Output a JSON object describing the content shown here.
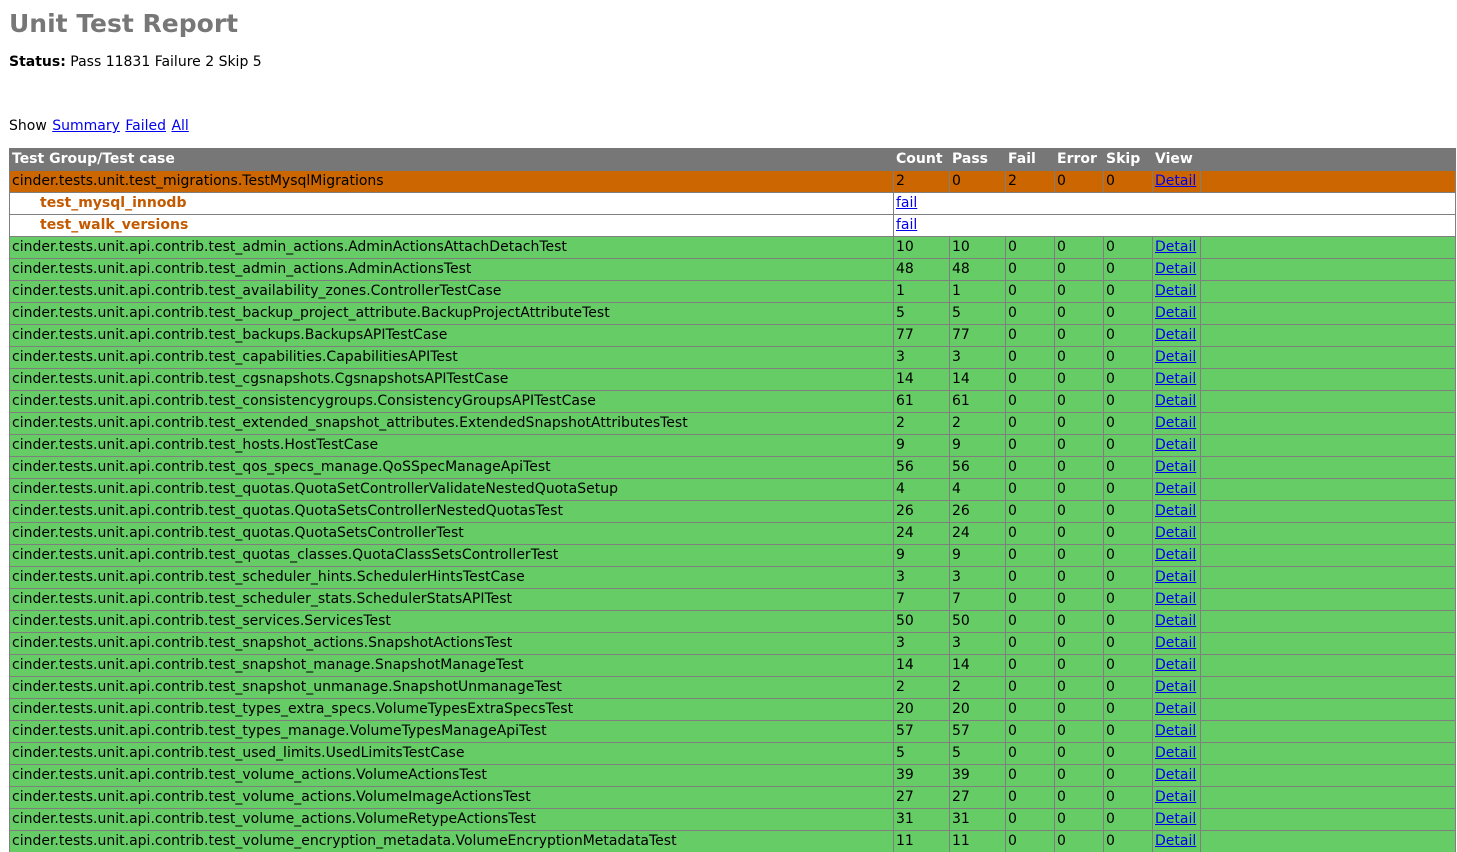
{
  "title": "Unit Test Report",
  "status": {
    "label": "Status:",
    "value": "Pass 11831 Failure 2 Skip 5"
  },
  "show": {
    "label": "Show",
    "summary": "Summary",
    "failed": "Failed",
    "all": "All"
  },
  "table": {
    "headers": [
      "Test Group/Test case",
      "Count",
      "Pass",
      "Fail",
      "Error",
      "Skip",
      "View"
    ],
    "detail_label": "Detail",
    "fail_label": "fail",
    "rows": [
      {
        "type": "group",
        "status": "fail",
        "name": "cinder.tests.unit.test_migrations.TestMysqlMigrations",
        "count": "2",
        "pass": "0",
        "fail": "2",
        "error": "0",
        "skip": "0"
      },
      {
        "type": "case",
        "name": "test_mysql_innodb",
        "result": "fail"
      },
      {
        "type": "case",
        "name": "test_walk_versions",
        "result": "fail"
      },
      {
        "type": "group",
        "status": "pass",
        "name": "cinder.tests.unit.api.contrib.test_admin_actions.AdminActionsAttachDetachTest",
        "count": "10",
        "pass": "10",
        "fail": "0",
        "error": "0",
        "skip": "0"
      },
      {
        "type": "group",
        "status": "pass",
        "name": "cinder.tests.unit.api.contrib.test_admin_actions.AdminActionsTest",
        "count": "48",
        "pass": "48",
        "fail": "0",
        "error": "0",
        "skip": "0"
      },
      {
        "type": "group",
        "status": "pass",
        "name": "cinder.tests.unit.api.contrib.test_availability_zones.ControllerTestCase",
        "count": "1",
        "pass": "1",
        "fail": "0",
        "error": "0",
        "skip": "0"
      },
      {
        "type": "group",
        "status": "pass",
        "name": "cinder.tests.unit.api.contrib.test_backup_project_attribute.BackupProjectAttributeTest",
        "count": "5",
        "pass": "5",
        "fail": "0",
        "error": "0",
        "skip": "0"
      },
      {
        "type": "group",
        "status": "pass",
        "name": "cinder.tests.unit.api.contrib.test_backups.BackupsAPITestCase",
        "count": "77",
        "pass": "77",
        "fail": "0",
        "error": "0",
        "skip": "0"
      },
      {
        "type": "group",
        "status": "pass",
        "name": "cinder.tests.unit.api.contrib.test_capabilities.CapabilitiesAPITest",
        "count": "3",
        "pass": "3",
        "fail": "0",
        "error": "0",
        "skip": "0"
      },
      {
        "type": "group",
        "status": "pass",
        "name": "cinder.tests.unit.api.contrib.test_cgsnapshots.CgsnapshotsAPITestCase",
        "count": "14",
        "pass": "14",
        "fail": "0",
        "error": "0",
        "skip": "0"
      },
      {
        "type": "group",
        "status": "pass",
        "name": "cinder.tests.unit.api.contrib.test_consistencygroups.ConsistencyGroupsAPITestCase",
        "count": "61",
        "pass": "61",
        "fail": "0",
        "error": "0",
        "skip": "0"
      },
      {
        "type": "group",
        "status": "pass",
        "name": "cinder.tests.unit.api.contrib.test_extended_snapshot_attributes.ExtendedSnapshotAttributesTest",
        "count": "2",
        "pass": "2",
        "fail": "0",
        "error": "0",
        "skip": "0"
      },
      {
        "type": "group",
        "status": "pass",
        "name": "cinder.tests.unit.api.contrib.test_hosts.HostTestCase",
        "count": "9",
        "pass": "9",
        "fail": "0",
        "error": "0",
        "skip": "0"
      },
      {
        "type": "group",
        "status": "pass",
        "name": "cinder.tests.unit.api.contrib.test_qos_specs_manage.QoSSpecManageApiTest",
        "count": "56",
        "pass": "56",
        "fail": "0",
        "error": "0",
        "skip": "0"
      },
      {
        "type": "group",
        "status": "pass",
        "name": "cinder.tests.unit.api.contrib.test_quotas.QuotaSetControllerValidateNestedQuotaSetup",
        "count": "4",
        "pass": "4",
        "fail": "0",
        "error": "0",
        "skip": "0"
      },
      {
        "type": "group",
        "status": "pass",
        "name": "cinder.tests.unit.api.contrib.test_quotas.QuotaSetsControllerNestedQuotasTest",
        "count": "26",
        "pass": "26",
        "fail": "0",
        "error": "0",
        "skip": "0"
      },
      {
        "type": "group",
        "status": "pass",
        "name": "cinder.tests.unit.api.contrib.test_quotas.QuotaSetsControllerTest",
        "count": "24",
        "pass": "24",
        "fail": "0",
        "error": "0",
        "skip": "0"
      },
      {
        "type": "group",
        "status": "pass",
        "name": "cinder.tests.unit.api.contrib.test_quotas_classes.QuotaClassSetsControllerTest",
        "count": "9",
        "pass": "9",
        "fail": "0",
        "error": "0",
        "skip": "0"
      },
      {
        "type": "group",
        "status": "pass",
        "name": "cinder.tests.unit.api.contrib.test_scheduler_hints.SchedulerHintsTestCase",
        "count": "3",
        "pass": "3",
        "fail": "0",
        "error": "0",
        "skip": "0"
      },
      {
        "type": "group",
        "status": "pass",
        "name": "cinder.tests.unit.api.contrib.test_scheduler_stats.SchedulerStatsAPITest",
        "count": "7",
        "pass": "7",
        "fail": "0",
        "error": "0",
        "skip": "0"
      },
      {
        "type": "group",
        "status": "pass",
        "name": "cinder.tests.unit.api.contrib.test_services.ServicesTest",
        "count": "50",
        "pass": "50",
        "fail": "0",
        "error": "0",
        "skip": "0"
      },
      {
        "type": "group",
        "status": "pass",
        "name": "cinder.tests.unit.api.contrib.test_snapshot_actions.SnapshotActionsTest",
        "count": "3",
        "pass": "3",
        "fail": "0",
        "error": "0",
        "skip": "0"
      },
      {
        "type": "group",
        "status": "pass",
        "name": "cinder.tests.unit.api.contrib.test_snapshot_manage.SnapshotManageTest",
        "count": "14",
        "pass": "14",
        "fail": "0",
        "error": "0",
        "skip": "0"
      },
      {
        "type": "group",
        "status": "pass",
        "name": "cinder.tests.unit.api.contrib.test_snapshot_unmanage.SnapshotUnmanageTest",
        "count": "2",
        "pass": "2",
        "fail": "0",
        "error": "0",
        "skip": "0"
      },
      {
        "type": "group",
        "status": "pass",
        "name": "cinder.tests.unit.api.contrib.test_types_extra_specs.VolumeTypesExtraSpecsTest",
        "count": "20",
        "pass": "20",
        "fail": "0",
        "error": "0",
        "skip": "0"
      },
      {
        "type": "group",
        "status": "pass",
        "name": "cinder.tests.unit.api.contrib.test_types_manage.VolumeTypesManageApiTest",
        "count": "57",
        "pass": "57",
        "fail": "0",
        "error": "0",
        "skip": "0"
      },
      {
        "type": "group",
        "status": "pass",
        "name": "cinder.tests.unit.api.contrib.test_used_limits.UsedLimitsTestCase",
        "count": "5",
        "pass": "5",
        "fail": "0",
        "error": "0",
        "skip": "0"
      },
      {
        "type": "group",
        "status": "pass",
        "name": "cinder.tests.unit.api.contrib.test_volume_actions.VolumeActionsTest",
        "count": "39",
        "pass": "39",
        "fail": "0",
        "error": "0",
        "skip": "0"
      },
      {
        "type": "group",
        "status": "pass",
        "name": "cinder.tests.unit.api.contrib.test_volume_actions.VolumeImageActionsTest",
        "count": "27",
        "pass": "27",
        "fail": "0",
        "error": "0",
        "skip": "0"
      },
      {
        "type": "group",
        "status": "pass",
        "name": "cinder.tests.unit.api.contrib.test_volume_actions.VolumeRetypeActionsTest",
        "count": "31",
        "pass": "31",
        "fail": "0",
        "error": "0",
        "skip": "0"
      },
      {
        "type": "group",
        "status": "pass",
        "name": "cinder.tests.unit.api.contrib.test_volume_encryption_metadata.VolumeEncryptionMetadataTest",
        "count": "11",
        "pass": "11",
        "fail": "0",
        "error": "0",
        "skip": "0"
      }
    ]
  },
  "colors": {
    "header_bg": "#777777",
    "fail_group_bg": "#cc6600",
    "pass_group_bg": "#66cc66",
    "case_name": "#c35900",
    "link": "#0000ee"
  }
}
